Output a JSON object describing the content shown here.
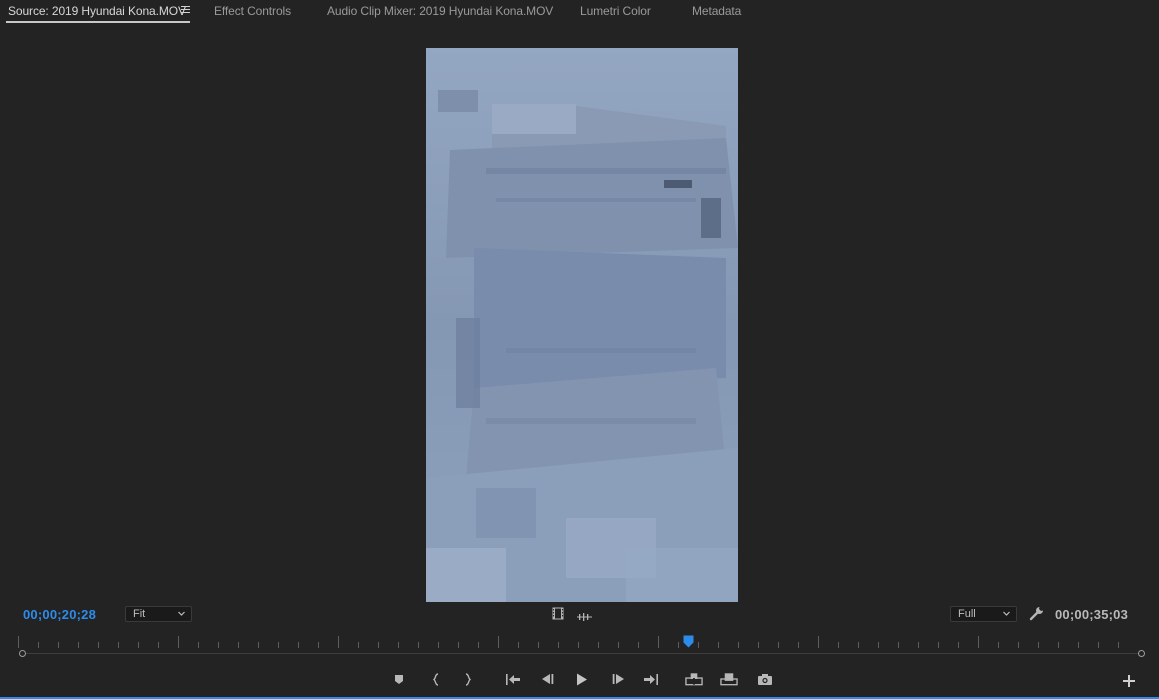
{
  "tabs": [
    {
      "label": "Source: 2019 Hyundai Kona.MOV",
      "active": true
    },
    {
      "label": "Effect Controls"
    },
    {
      "label": "Audio Clip Mixer: 2019 Hyundai Kona.MOV"
    },
    {
      "label": "Lumetri Color"
    },
    {
      "label": "Metadata"
    }
  ],
  "monitor": {
    "current_timecode": "00;00;20;28",
    "duration_timecode": "00;00;35;03",
    "zoom_select": "Fit",
    "resolution_select": "Full",
    "playhead_fraction": 0.595
  },
  "icons": {
    "panel_menu": "hamburger-icon",
    "drag_video": "film-icon",
    "drag_audio": "waveform-icon",
    "settings": "wrench-icon",
    "add_marker": "marker-icon",
    "mark_in": "mark-in-icon",
    "mark_out": "mark-out-icon",
    "go_to_in": "go-to-in-icon",
    "step_back": "step-back-icon",
    "play": "play-icon",
    "step_forward": "step-forward-icon",
    "go_to_out": "go-to-out-icon",
    "insert": "insert-icon",
    "overwrite": "overwrite-icon",
    "export_frame": "camera-icon",
    "button_editor": "plus-icon"
  },
  "colors": {
    "accent": "#2d8ceb",
    "panel_bg": "#232323"
  }
}
